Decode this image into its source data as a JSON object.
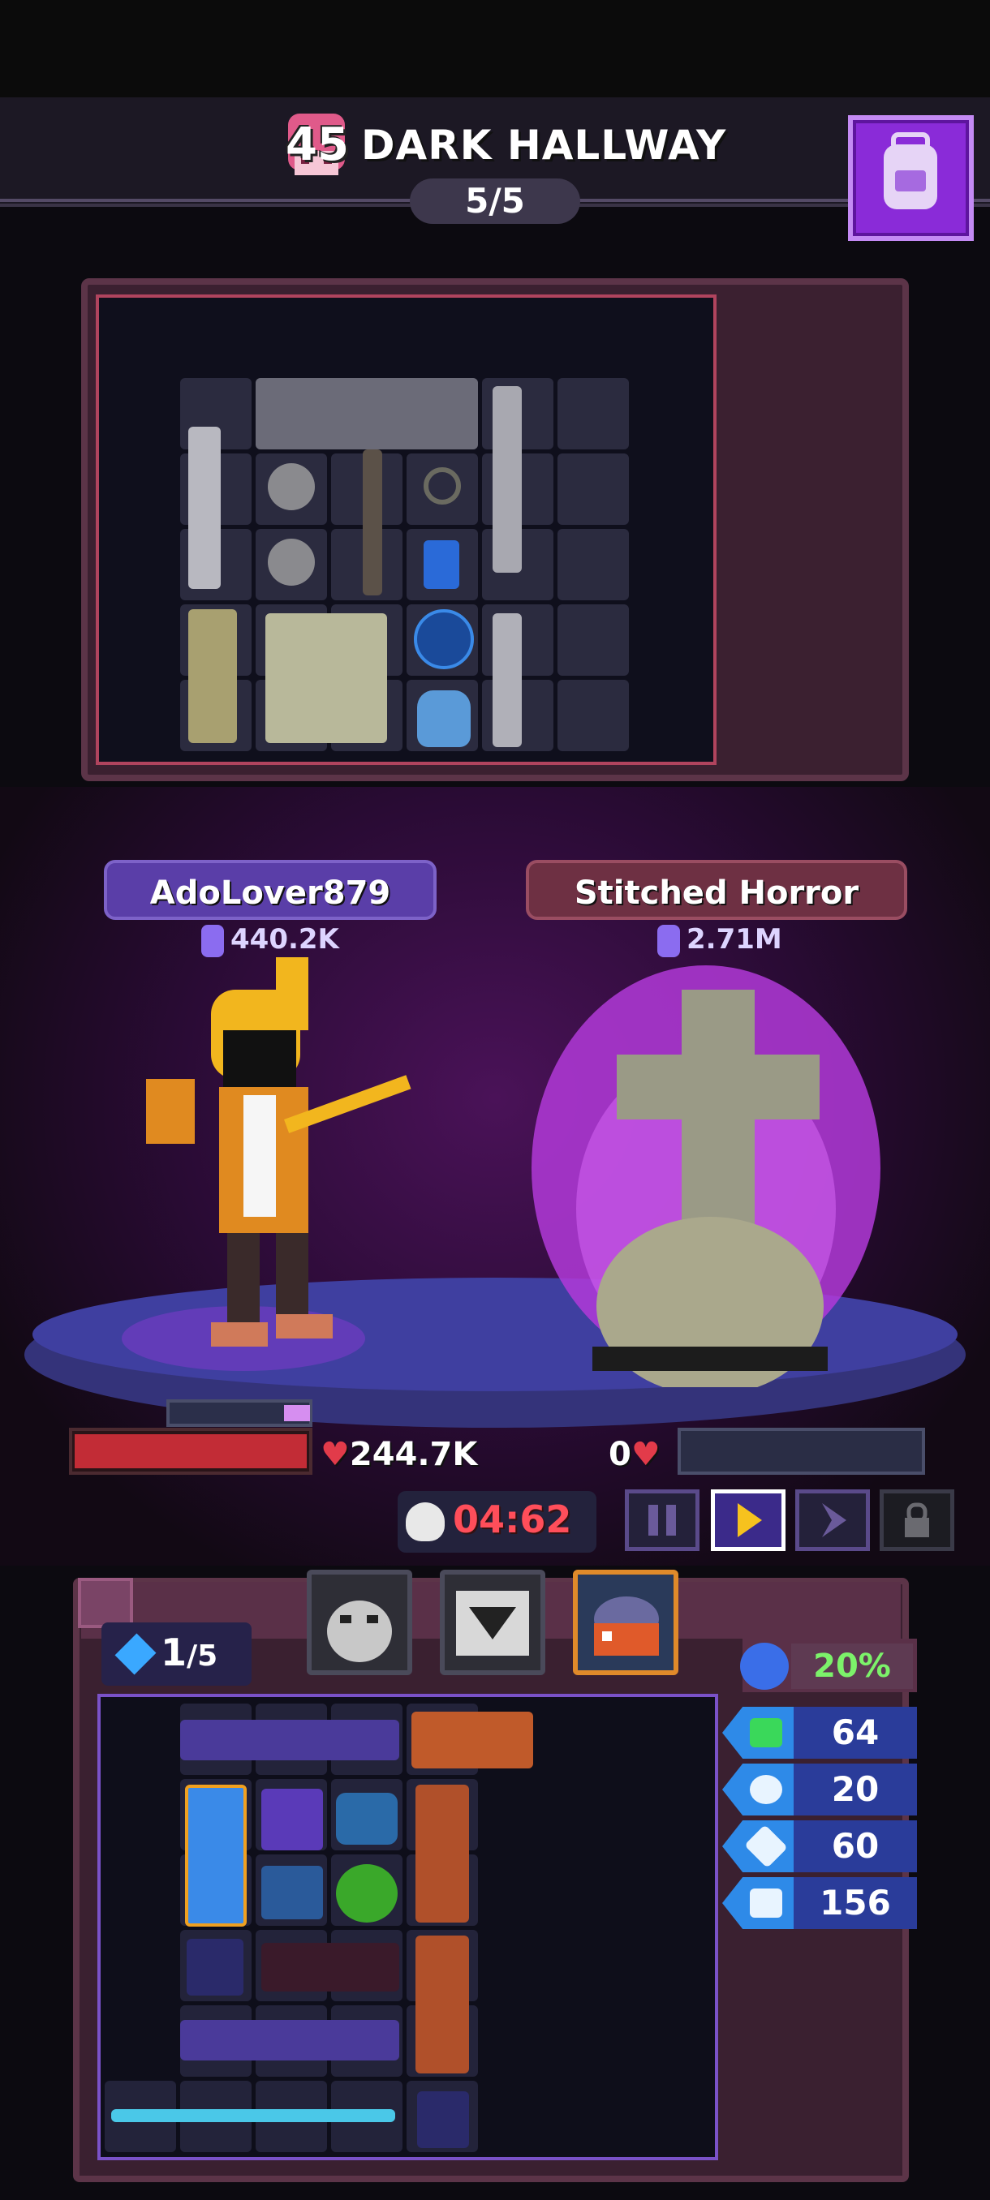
{
  "header": {
    "level": "45",
    "area_name": "DARK HALLWAY",
    "wave": "5/5"
  },
  "battle": {
    "player": {
      "name": "AdoLover879",
      "power": "440.2K",
      "hp": "244.7K",
      "hp_fraction": 1.0
    },
    "enemy": {
      "name": "Stitched Horror",
      "power": "2.71M",
      "hp": "0",
      "hp_fraction": 0.0
    },
    "timer": "04:62"
  },
  "controls": {
    "pause": "pause-icon",
    "play": "play-icon",
    "fast_forward": "fast-forward-icon",
    "locked": "lock-icon"
  },
  "backpack": {
    "gems": "1",
    "gems_max": "/5",
    "luck": "20%",
    "stats": [
      {
        "icon": "speed-icon",
        "value": "64"
      },
      {
        "icon": "target-icon",
        "value": "20"
      },
      {
        "icon": "crit-icon",
        "value": "60"
      },
      {
        "icon": "boot-icon",
        "value": "156"
      }
    ]
  },
  "colors": {
    "accent_purple": "#8a2bd8",
    "timer_red": "#ff4e5a",
    "hp_red": "#c22c36",
    "luck_green": "#7cf26a",
    "stat_blue": "#2a3c9a"
  }
}
